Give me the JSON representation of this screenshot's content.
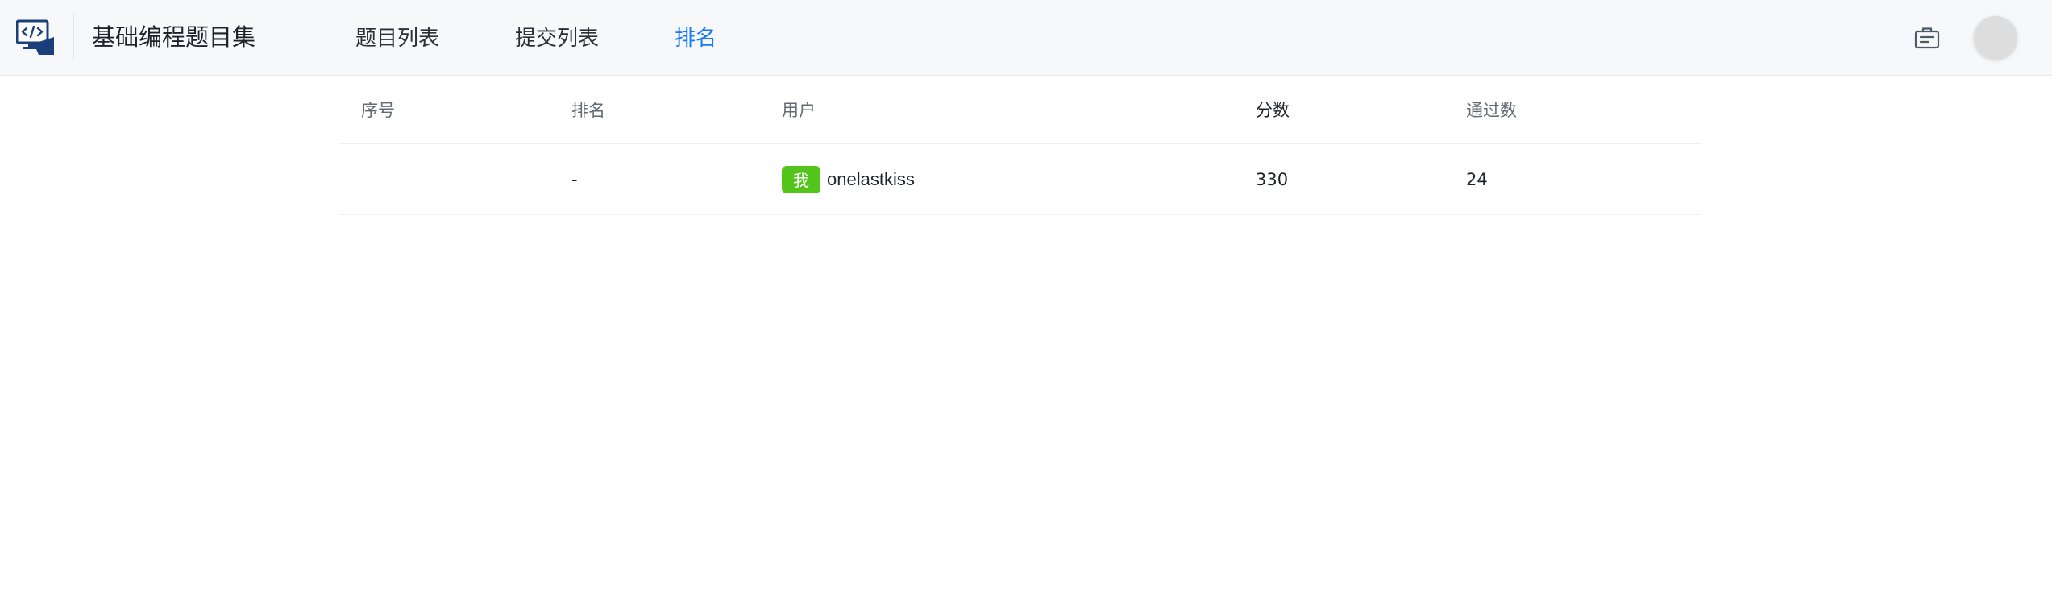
{
  "header": {
    "logo_icon": "code-monitor-icon",
    "app_title": "基础编程题目集",
    "tabs": [
      {
        "label": "题目列表",
        "active": false
      },
      {
        "label": "提交列表",
        "active": false
      },
      {
        "label": "排名",
        "active": true
      }
    ],
    "right_icon": "id-card-icon",
    "accent_color": "#1677ff"
  },
  "ranking_table": {
    "columns": [
      "序号",
      "排名",
      "用户",
      "分数",
      "通过数"
    ],
    "rows": [
      {
        "index": "",
        "rank": "-",
        "badge": "我",
        "badge_color": "#52c41a",
        "user": "onelastkiss",
        "score": "330",
        "passed": "24"
      }
    ]
  }
}
